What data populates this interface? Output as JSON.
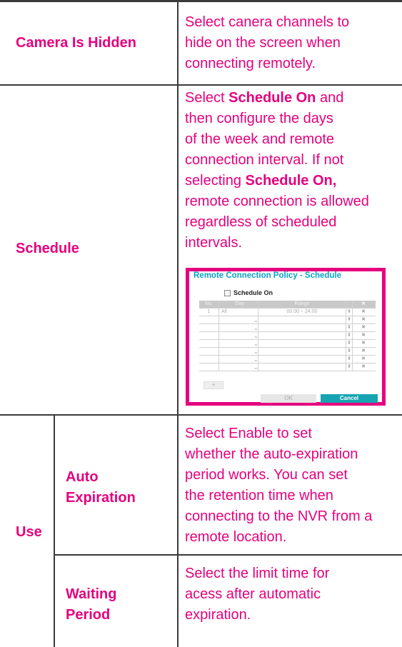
{
  "rows": {
    "camera_hidden": {
      "label": "Camera Is Hidden",
      "desc": [
        "Select canera channels to",
        "hide on the screen when",
        "connecting remotely."
      ]
    },
    "schedule": {
      "label": "Schedule",
      "desc_1": "Select ",
      "desc_bold_1": "Schedule On",
      "desc_2": " and",
      "desc_3": "then configure the days",
      "desc_4": "of the week and remote",
      "desc_5": "connection interval. If not",
      "desc_6": "selecting ",
      "desc_bold_2": "Schedule On,",
      "desc_7": "remote connection is allowed",
      "desc_8": "regardless of scheduled",
      "desc_9": "intervals."
    },
    "use": {
      "label": "Use",
      "auto_expiration": {
        "label_1": "Auto",
        "label_2": "Expiration",
        "desc": [
          "Select Enable to set",
          "whether the auto-expiration",
          "period works. You can set",
          "the retention time when",
          "connecting to the NVR from a",
          "remote location."
        ]
      },
      "waiting_period": {
        "label_1": "Waiting",
        "label_2": "Period",
        "desc": [
          "Select the limit time for",
          "acess after automatic",
          "expiration."
        ]
      }
    }
  },
  "dialog": {
    "title": "Remote Connection Policy - Schedule",
    "checkbox_label": "Schedule On",
    "columns": [
      "No.",
      "Day",
      "Range",
      "",
      "✖"
    ],
    "first_row": {
      "no": "1",
      "day": "All",
      "range": "00:00 ~ 24:00"
    },
    "empty_rows": 7,
    "add_label": "+",
    "ok_label": "OK",
    "cancel_label": "Cancel"
  },
  "colors": {
    "accent": "#e5007e",
    "dialog_title": "#0aa0c8",
    "cancel": "#16a4b2"
  }
}
